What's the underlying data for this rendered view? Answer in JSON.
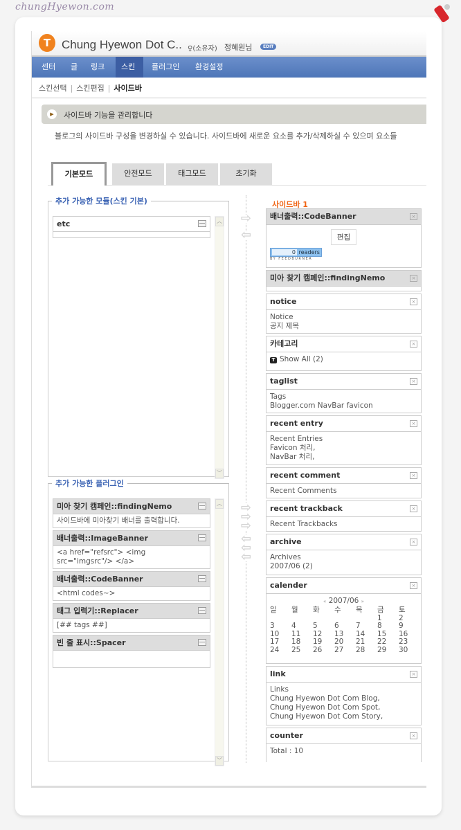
{
  "site_logo": "chungHyewon.com",
  "header": {
    "blog_title": "Chung Hyewon Dot C..",
    "owner_label": "(소유자)",
    "username": "정혜원님",
    "edit_label": "EDIT"
  },
  "nav": {
    "items": [
      "센터",
      "글",
      "링크",
      "스킨",
      "플러그인",
      "환경설정"
    ],
    "active": "스킨"
  },
  "subnav": {
    "items": [
      "스킨선택",
      "스킨편집",
      "사이드바"
    ],
    "active": "사이드바"
  },
  "notice": {
    "title": "사이드바 기능을 관리합니다",
    "description": "블로그의 사이드바 구성을 변경하실 수 있습니다. 사이드바에 새로운 요소를 추가/삭제하실 수 있으며 요소들"
  },
  "tabs": [
    "기본모드",
    "안전모드",
    "태그모드",
    "초기화"
  ],
  "left": {
    "skin_modules_title": "추가 가능한 모듈(스킨 기본)",
    "skin_modules": [
      {
        "title": "etc"
      }
    ],
    "plugins_title": "추가 가능한 플러그인",
    "plugins": [
      {
        "title": "미아 찾기 캠페인::findingNemo",
        "body": [
          "사이드바에 미아찾기 배너를 출력합니다."
        ]
      },
      {
        "title": "배너출력::ImageBanner",
        "body": [
          "<a href=\"refsrc\"> <img",
          "src=\"imgsrc\"/> </a>"
        ]
      },
      {
        "title": "배너출력::CodeBanner",
        "body": [
          "<html codes~>"
        ]
      },
      {
        "title": "태그 입력기::Replacer",
        "body": [
          "[## tags ##]"
        ]
      },
      {
        "title": "빈 줄 표시::Spacer",
        "body": [
          ""
        ]
      }
    ]
  },
  "sidebar": {
    "title": "사이드바 1",
    "codebanner": {
      "title": "배너출력::CodeBanner",
      "edit_button": "편집",
      "readers_count": "0",
      "readers_label": "readers",
      "feed_credit": "BY FEEDBURNER"
    },
    "nemo": {
      "title": "미아 찾기 캠페인::findingNemo"
    },
    "widgets": [
      {
        "title": "notice",
        "body": [
          "Notice",
          "공지 제목"
        ]
      },
      {
        "title": "카테고리",
        "body": [
          "Show All (2)"
        ],
        "icon": "tistory-t-icon"
      },
      {
        "title": "taglist",
        "body": [
          "Tags",
          "Blogger.com NavBar favicon"
        ]
      },
      {
        "title": "recent entry",
        "body": [
          "Recent Entries",
          "Favicon 처리,",
          "NavBar 처리,"
        ]
      },
      {
        "title": "recent comment",
        "body": [
          "Recent Comments"
        ]
      },
      {
        "title": "recent trackback",
        "body": [
          "Recent Trackbacks"
        ]
      },
      {
        "title": "archive",
        "body": [
          "Archives",
          "2007/06 (2)"
        ]
      }
    ],
    "calendar": {
      "title": "calender",
      "prev": "«",
      "month": "2007/06",
      "next": "»",
      "weekdays": [
        "일",
        "월",
        "화",
        "수",
        "목",
        "금",
        "토"
      ],
      "days": [
        "",
        "",
        "",
        "",
        "",
        "1",
        "2",
        "3",
        "4",
        "5",
        "6",
        "7",
        "8",
        "9",
        "10",
        "11",
        "12",
        "13",
        "14",
        "15",
        "16",
        "17",
        "18",
        "19",
        "20",
        "21",
        "22",
        "23",
        "24",
        "25",
        "26",
        "27",
        "28",
        "29",
        "30"
      ]
    },
    "widgets2": [
      {
        "title": "link",
        "body": [
          "Links",
          "Chung Hyewon Dot Com Blog,",
          "Chung Hyewon Dot Com Spot,",
          "Chung Hyewon Dot Com Story,"
        ]
      },
      {
        "title": "counter",
        "body": [
          "Total : 10"
        ]
      }
    ]
  },
  "colors": {
    "nav": "#5a82bf",
    "nav_active": "#3c5ea3",
    "accent_orange": "#f06414",
    "legend_blue": "#3c64b4"
  }
}
